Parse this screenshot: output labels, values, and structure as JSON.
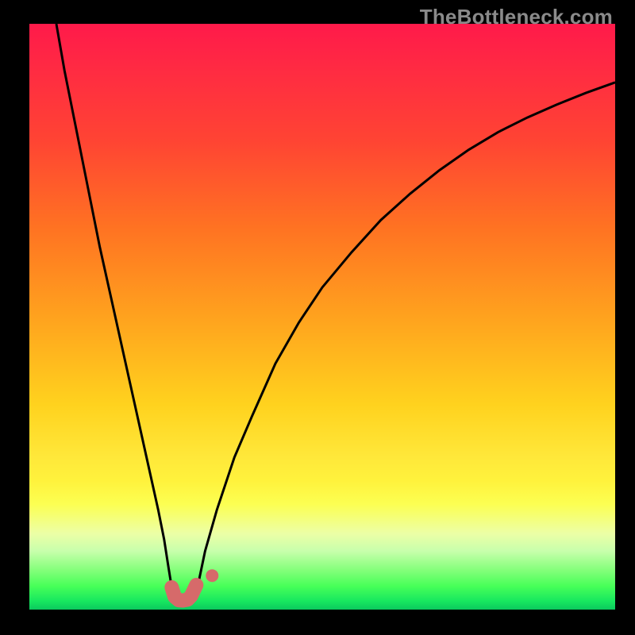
{
  "watermark": "TheBottleneck.com",
  "chart_data": {
    "type": "line",
    "title": "",
    "xlabel": "",
    "ylabel": "",
    "xlim": [
      0,
      100
    ],
    "ylim": [
      0,
      100
    ],
    "grid": false,
    "legend": false,
    "background_gradient": [
      {
        "stop": 0,
        "color": "#ff1a4a"
      },
      {
        "stop": 50,
        "color": "#ffa21e"
      },
      {
        "stop": 80,
        "color": "#fff23c"
      },
      {
        "stop": 100,
        "color": "#0bc95e"
      }
    ],
    "series": [
      {
        "name": "left-curve",
        "color": "#000000",
        "stroke_width": 3,
        "x": [
          4.6,
          6,
          8,
          10,
          12,
          14,
          16,
          18,
          20,
          22,
          23,
          23.7,
          24.3
        ],
        "y": [
          100,
          92,
          82,
          72,
          62,
          53,
          44,
          35,
          26,
          17,
          12,
          7.5,
          3.8
        ]
      },
      {
        "name": "right-curve",
        "color": "#000000",
        "stroke_width": 3,
        "x": [
          28.7,
          30,
          32,
          35,
          38,
          42,
          46,
          50,
          55,
          60,
          65,
          70,
          75,
          80,
          85,
          90,
          95,
          100
        ],
        "y": [
          3.8,
          10,
          17,
          26,
          33,
          42,
          49,
          55,
          61,
          66.5,
          71,
          75,
          78.5,
          81.5,
          84,
          86.2,
          88.2,
          90
        ]
      },
      {
        "name": "valley-connector",
        "color": "#d66a6a",
        "stroke_width": 18,
        "linecap": "round",
        "x": [
          24.3,
          24.8,
          25.5,
          26.2,
          27.0,
          27.6,
          28.5
        ],
        "y": [
          3.8,
          2.2,
          1.6,
          1.55,
          1.7,
          2.3,
          4.2
        ]
      },
      {
        "name": "valley-dot-right",
        "type": "scatter",
        "color": "#d66a6a",
        "radius": 8,
        "x": [
          31.2
        ],
        "y": [
          5.8
        ]
      }
    ]
  }
}
